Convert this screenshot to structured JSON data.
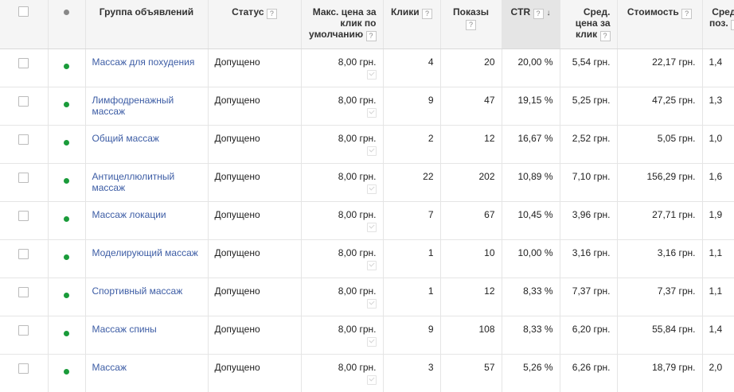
{
  "columns": {
    "ad_group": "Группа объявлений",
    "status": "Статус",
    "max_cpc": "Макс. цена за клик по умолчанию",
    "clicks": "Клики",
    "impressions": "Показы",
    "ctr": "CTR",
    "avg_cpc": "Сред. цена за клик",
    "cost": "Стоимость",
    "avg_pos": "Сред. поз."
  },
  "help_glyph": "?",
  "sort_arrow": "↓",
  "rows": [
    {
      "name": "Массаж для похудения",
      "status": "Допущено",
      "max_cpc": "8,00 грн.",
      "clicks": "4",
      "impressions": "20",
      "ctr": "20,00 %",
      "avg_cpc": "5,54 грн.",
      "cost": "22,17 грн.",
      "avg_pos": "1,4"
    },
    {
      "name": "Лимфодренажный массаж",
      "status": "Допущено",
      "max_cpc": "8,00 грн.",
      "clicks": "9",
      "impressions": "47",
      "ctr": "19,15 %",
      "avg_cpc": "5,25 грн.",
      "cost": "47,25 грн.",
      "avg_pos": "1,3"
    },
    {
      "name": "Общий массаж",
      "status": "Допущено",
      "max_cpc": "8,00 грн.",
      "clicks": "2",
      "impressions": "12",
      "ctr": "16,67 %",
      "avg_cpc": "2,52 грн.",
      "cost": "5,05 грн.",
      "avg_pos": "1,0"
    },
    {
      "name": "Антицеллюлитный массаж",
      "status": "Допущено",
      "max_cpc": "8,00 грн.",
      "clicks": "22",
      "impressions": "202",
      "ctr": "10,89 %",
      "avg_cpc": "7,10 грн.",
      "cost": "156,29 грн.",
      "avg_pos": "1,6"
    },
    {
      "name": "Массаж локации",
      "status": "Допущено",
      "max_cpc": "8,00 грн.",
      "clicks": "7",
      "impressions": "67",
      "ctr": "10,45 %",
      "avg_cpc": "3,96 грн.",
      "cost": "27,71 грн.",
      "avg_pos": "1,9"
    },
    {
      "name": "Моделирующий массаж",
      "status": "Допущено",
      "max_cpc": "8,00 грн.",
      "clicks": "1",
      "impressions": "10",
      "ctr": "10,00 %",
      "avg_cpc": "3,16 грн.",
      "cost": "3,16 грн.",
      "avg_pos": "1,1"
    },
    {
      "name": "Спортивный массаж",
      "status": "Допущено",
      "max_cpc": "8,00 грн.",
      "clicks": "1",
      "impressions": "12",
      "ctr": "8,33 %",
      "avg_cpc": "7,37 грн.",
      "cost": "7,37 грн.",
      "avg_pos": "1,1"
    },
    {
      "name": "Массаж спины",
      "status": "Допущено",
      "max_cpc": "8,00 грн.",
      "clicks": "9",
      "impressions": "108",
      "ctr": "8,33 %",
      "avg_cpc": "6,20 грн.",
      "cost": "55,84 грн.",
      "avg_pos": "1,4"
    },
    {
      "name": "Массаж",
      "status": "Допущено",
      "max_cpc": "8,00 грн.",
      "clicks": "3",
      "impressions": "57",
      "ctr": "5,26 %",
      "avg_cpc": "6,26 грн.",
      "cost": "18,79 грн.",
      "avg_pos": "2,0"
    }
  ],
  "colors": {
    "enabled_dot": "#1a9b3a",
    "link": "#3d5da5",
    "header_bg": "#f5f5f5",
    "sorted_header_bg": "#e5e5e5"
  },
  "icons": {
    "row_status": "green-dot-icon",
    "edit": "pencil-check-icon"
  }
}
